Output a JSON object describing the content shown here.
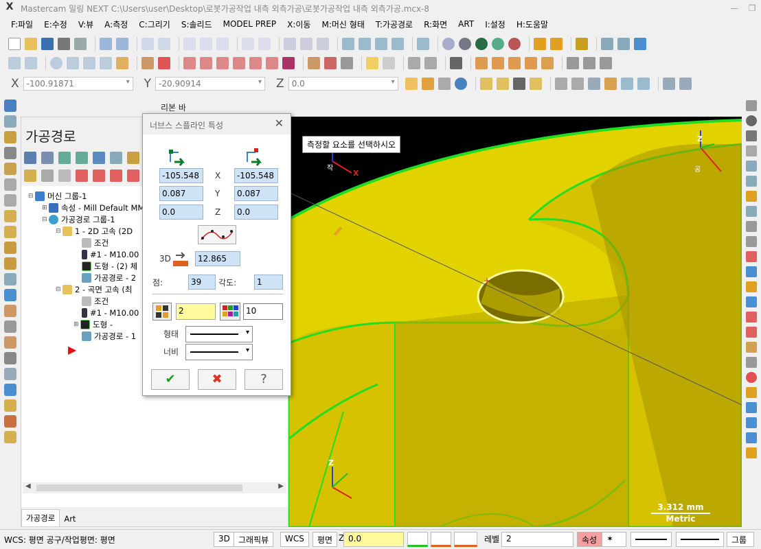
{
  "window": {
    "title": "Mastercam 밀링 NEXT  C:\\Users\\user\\Desktop\\로봇가공작업 내측 외측가공\\로봇가공작업 내측 외측가공.mcx-8",
    "app_icon": "X"
  },
  "menu": [
    "F:파일",
    "E:수정",
    "V:뷰",
    "A:측정",
    "C:그리기",
    "S:솔리드",
    "MODEL PREP",
    "X:이동",
    "M:머신 형태",
    "T:가공경로",
    "R:화면",
    "ART",
    "I:설정",
    "H:도움말"
  ],
  "coords": {
    "x_label": "X",
    "x_value": "-100.91871",
    "y_label": "Y",
    "y_value": "-20.90914",
    "z_label": "Z",
    "z_value": "0.0"
  },
  "ribbon_label": "리본 바",
  "panel": {
    "title": "가공경로",
    "tree": [
      {
        "label": "머신 그룹-1"
      },
      {
        "label": "속성 - Mill Default MM"
      },
      {
        "label": "가공경로 그룹-1"
      },
      {
        "label": "1 - 2D 고속 (2D"
      },
      {
        "label": "조건"
      },
      {
        "label": "#1 - M10.00"
      },
      {
        "label": "도형 - (2) 체"
      },
      {
        "label": "가공경로 - 2"
      },
      {
        "label": "2 - 곡면 고속 (최"
      },
      {
        "label": "조건"
      },
      {
        "label": "#1 - M10.00"
      },
      {
        "label": "도형 -"
      },
      {
        "label": "가공경로 - 1"
      }
    ],
    "tabs": [
      "가공경로",
      "Art"
    ]
  },
  "viewport": {
    "prompt": "측정할 요소를 선택하시오",
    "scale_value": "3.312 mm",
    "scale_unit": "Metric",
    "triad_top_left": {
      "z": "",
      "x": "X",
      "label": "작"
    },
    "triad_top_right": {
      "z": "Z",
      "label": "공"
    },
    "triad_bottom": {
      "z": "Z"
    }
  },
  "dialog": {
    "title": "너브스 스플라인 특성",
    "start": {
      "x": "-105.548",
      "y": "0.087",
      "z": "0.0"
    },
    "end": {
      "x": "-105.548",
      "y": "0.087",
      "z": "0.0"
    },
    "x_label": "X",
    "y_label": "Y",
    "z_label": "Z",
    "label_3d": "3D",
    "length_3d": "12.865",
    "points_label": "점:",
    "points_value": "39",
    "angle_label": "각도:",
    "angle_value": "1",
    "level_value": "2",
    "color_value": "10",
    "style_label": "형태",
    "width_label": "너비"
  },
  "statusbar": {
    "wcs_text": "WCS: 평면  공구/작업평면: 평면",
    "btn_3d": "3D",
    "btn_graphics": "그래픽뷰",
    "btn_wcs": "WCS",
    "btn_plane": "평면",
    "z_label": "Z",
    "z_value": "0.0",
    "level_label": "레벨",
    "level_value": "2",
    "attr_label": "속성",
    "group_label": "그룹"
  },
  "colors": {
    "part_yellow": "#d6c200",
    "part_edge_green": "#22dd22",
    "viewport_bg": "#000000",
    "dialog_field": "#cfe3f7"
  }
}
